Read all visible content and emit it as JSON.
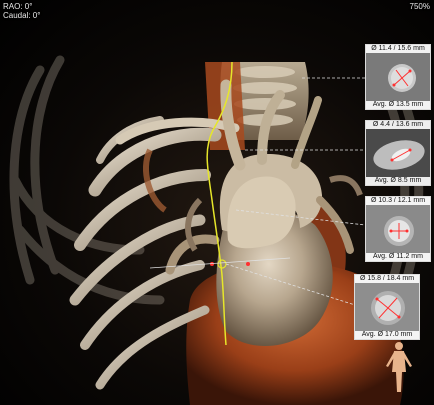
{
  "overlay": {
    "view_line1": "RAO: 0°",
    "view_line2": "Caudal: 0°",
    "zoom": "750%"
  },
  "panels": [
    {
      "diameter": "Ø 11.4 / 15.6 mm",
      "average": "Avg. Ø 13.5 mm"
    },
    {
      "diameter": "Ø 4.4 / 13.6 mm",
      "average": "Avg. Ø 8.5 mm"
    },
    {
      "diameter": "Ø 10.3 / 12.1 mm",
      "average": "Avg. Ø 11.2 mm"
    },
    {
      "diameter": "Ø 15.8 / 18.4 mm",
      "average": "Avg. Ø 17.0 mm"
    }
  ],
  "colors": {
    "centerline": "#e6e62a",
    "measure_marker": "#ff3030",
    "bone": "#c9bda8",
    "myocardium": "#b04a1f"
  },
  "icons": [
    "orientation-figure-icon"
  ]
}
